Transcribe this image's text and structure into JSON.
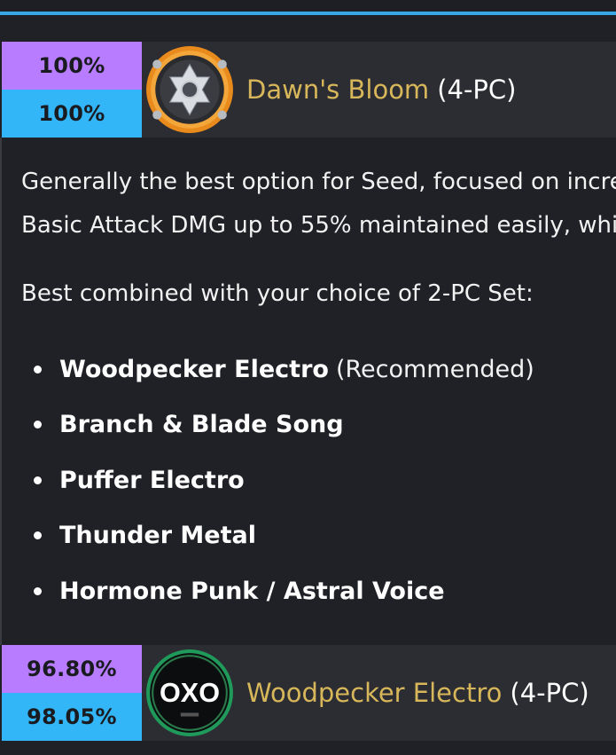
{
  "sets": [
    {
      "pct_top": "100%",
      "pct_bottom": "100%",
      "icon": "dawns-bloom-icon",
      "name": "Dawn's Bloom",
      "suffix": "(4-PC)"
    },
    {
      "pct_top": "96.80%",
      "pct_bottom": "98.05%",
      "icon": "woodpecker-electro-icon",
      "icon_text": "OXO",
      "name": "Woodpecker Electro",
      "suffix": "(4-PC)"
    }
  ],
  "description": {
    "line1": "Generally the best option for Seed, focused on incre",
    "line2": "Basic Attack DMG up to 55% maintained easily, whi"
  },
  "combo_text": "Best combined with your choice of 2-PC Set:",
  "options": [
    {
      "name": "Woodpecker Electro",
      "note": "(Recommended)"
    },
    {
      "name": "Branch & Blade Song",
      "note": ""
    },
    {
      "name": "Puffer Electro",
      "note": ""
    },
    {
      "name": "Thunder Metal",
      "note": ""
    },
    {
      "name": "Hormone Punk / Astral Voice",
      "note": ""
    }
  ],
  "colors": {
    "accent_line": "#39a8e8",
    "pct_purple": "#b77cff",
    "pct_blue": "#32b6f8",
    "set_name_gold": "#d7b75a"
  }
}
